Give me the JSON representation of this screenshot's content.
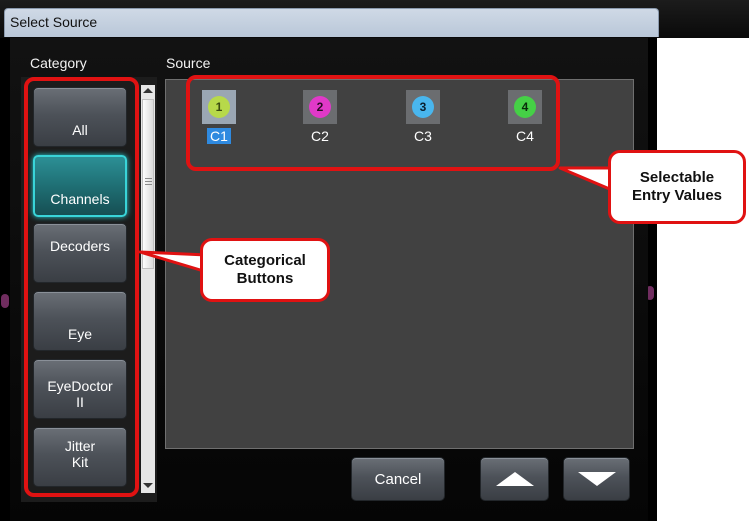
{
  "window": {
    "title": "Select Source"
  },
  "labels": {
    "category": "Category",
    "source": "Source"
  },
  "categories": [
    {
      "label": "All",
      "active": false
    },
    {
      "label": "Channels",
      "active": true
    },
    {
      "label": "Decoders",
      "active": false
    },
    {
      "label": "Eye",
      "active": false
    },
    {
      "label": "EyeDoctor\nII",
      "active": false
    },
    {
      "label": "Jitter\nKit",
      "active": false
    }
  ],
  "sources": [
    {
      "number": "1",
      "label": "C1",
      "color": "#b7d94a",
      "selected": true
    },
    {
      "number": "2",
      "label": "C2",
      "color": "#e039c8",
      "selected": false
    },
    {
      "number": "3",
      "label": "C3",
      "color": "#49b6ee",
      "selected": false
    },
    {
      "number": "4",
      "label": "C4",
      "color": "#45d046",
      "selected": false
    }
  ],
  "buttons": {
    "cancel": "Cancel"
  },
  "annotations": {
    "categorical": "Categorical\nButtons",
    "selectable": "Selectable\nEntry Values"
  },
  "colors": {
    "highlight": "#e01212",
    "active_border": "#39d4d8",
    "selection": "#2f8ae0"
  }
}
